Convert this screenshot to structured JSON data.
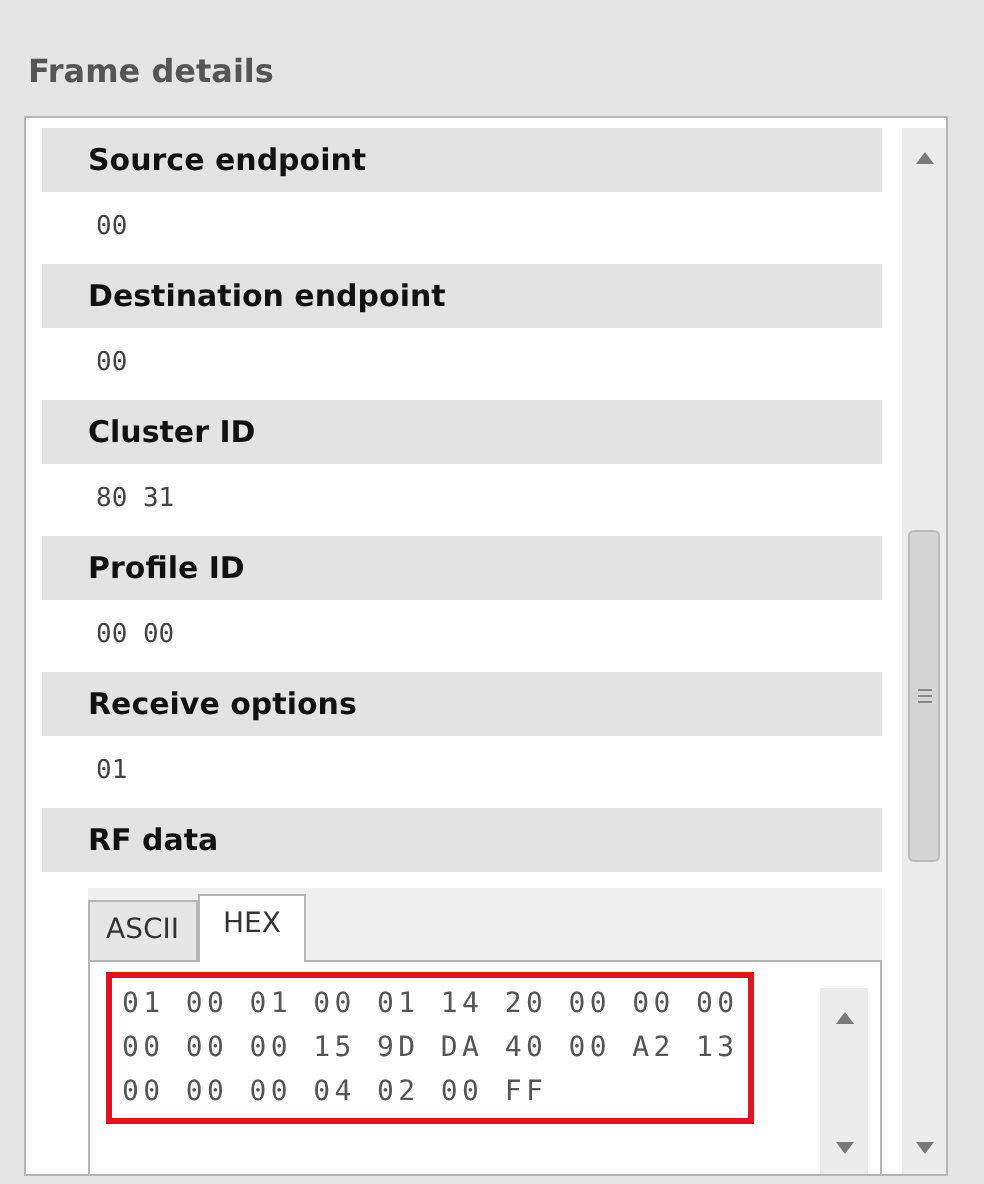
{
  "section_title": "Frame details",
  "fields": [
    {
      "label": "Source endpoint",
      "value": "00"
    },
    {
      "label": "Destination endpoint",
      "value": "00"
    },
    {
      "label": "Cluster ID",
      "value": "80 31"
    },
    {
      "label": "Profile ID",
      "value": "00 00"
    },
    {
      "label": "Receive options",
      "value": "01"
    }
  ],
  "rf_data": {
    "label": "RF data",
    "tabs": [
      {
        "label": "ASCII",
        "selected": false
      },
      {
        "label": "HEX",
        "selected": true
      }
    ],
    "highlighted": true,
    "lines": [
      "01 00 01 00 01 14 20 00 00 00",
      "00 00 00 15 9D DA 40 00 A2 13",
      "00 00 00 04 02 00 FF"
    ]
  }
}
